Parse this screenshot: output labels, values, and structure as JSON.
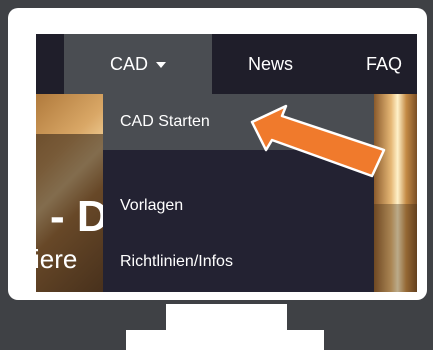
{
  "nav": {
    "cad_label": "CAD",
    "news_label": "News",
    "faq_label": "FAQ"
  },
  "dropdown": {
    "items": [
      {
        "label": "CAD Starten",
        "active": true
      },
      {
        "label": "Vorlagen",
        "active": false
      },
      {
        "label": "Richtlinien/Infos",
        "active": false
      }
    ]
  },
  "hero": {
    "big_text": "- D",
    "small_text": "iere"
  },
  "colors": {
    "page_bg": "#3f4145",
    "navbar_bg": "#1f1e2a",
    "active_item_bg": "#4a4d52",
    "dropdown_bg": "#232232",
    "arrow": "#f07a2c"
  },
  "icons": {
    "caret": "chevron-down-icon",
    "pointer": "arrow-pointer-icon"
  }
}
